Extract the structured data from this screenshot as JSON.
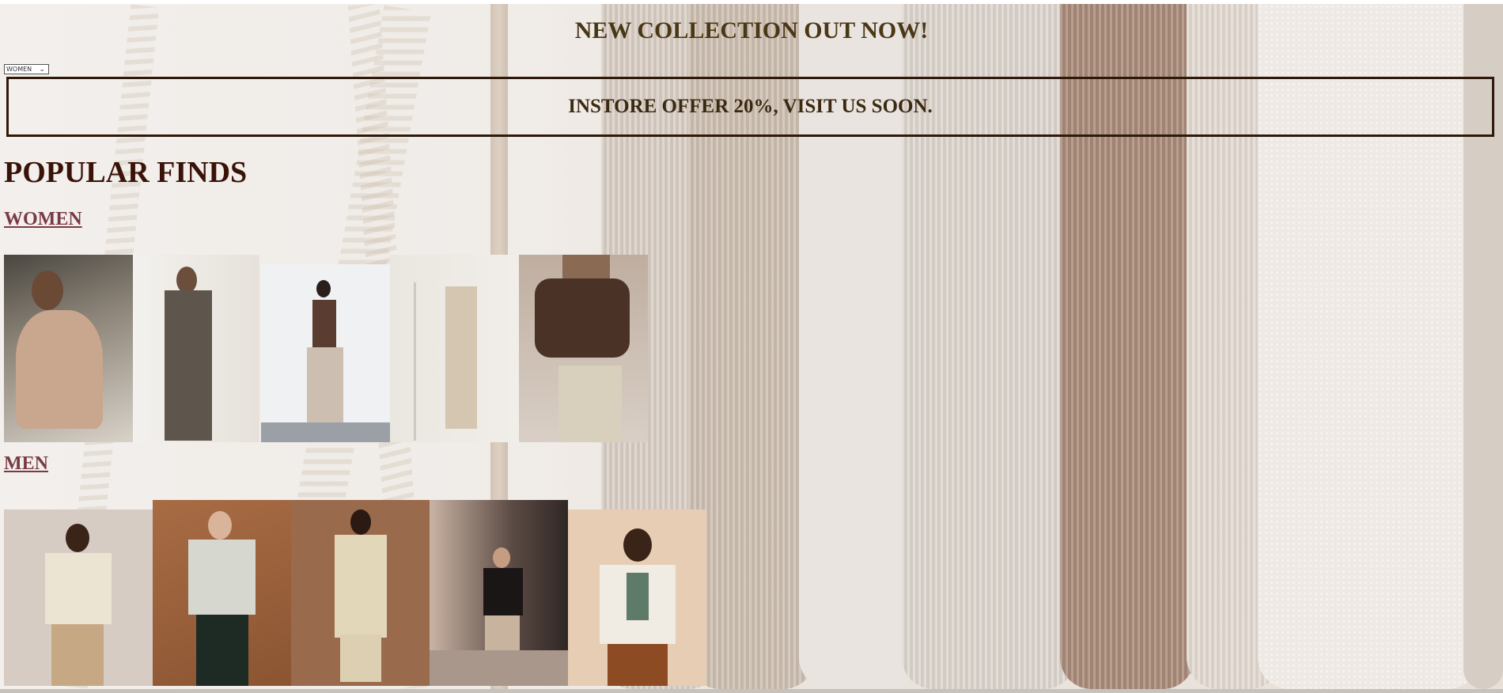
{
  "banner": {
    "headline": "NEW COLLECTION OUT NOW!"
  },
  "category_select": {
    "selected": "WOMEN",
    "icon": "chevron-down-icon"
  },
  "offer": {
    "text": "INSTORE OFFER 20%, VISIT US SOON."
  },
  "popular": {
    "title": "POPULAR FINDS",
    "women_label": "WOMEN",
    "men_label": "MEN"
  }
}
